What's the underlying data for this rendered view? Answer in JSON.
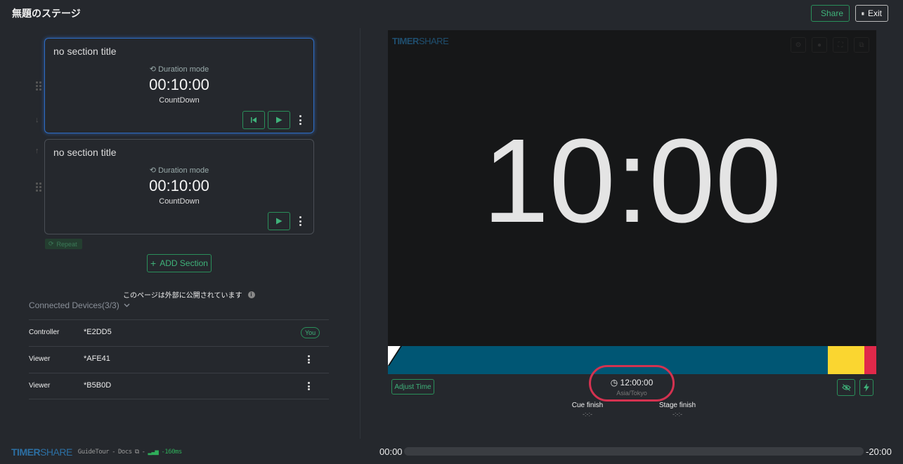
{
  "header": {
    "title": "無題のステージ",
    "share_label": "Share",
    "exit_label": "Exit"
  },
  "sections": [
    {
      "title": "no section title",
      "mode_label": "Duration mode",
      "duration": "00:10:00",
      "type": "CountDown",
      "active": true
    },
    {
      "title": "no section title",
      "mode_label": "Duration mode",
      "duration": "00:10:00",
      "type": "CountDown",
      "active": false
    }
  ],
  "repeat_label": "Repeat",
  "add_section_label": "ADD Section",
  "public_notice": "このページは外部に公開されています",
  "connected": {
    "label": "Connected Devices(3/3)",
    "devices": [
      {
        "role": "Controller",
        "id": "*E2DD5",
        "badge": "You"
      },
      {
        "role": "Viewer",
        "id": "*AFE41"
      },
      {
        "role": "Viewer",
        "id": "*B5B0D"
      }
    ]
  },
  "footer": {
    "brand_timer": "TIMER",
    "brand_share": "SHARE",
    "guide_tour": "GuideTour",
    "docs": "Docs",
    "ping": "-160ms"
  },
  "stage": {
    "brand_timer": "TIMER",
    "brand_share": "SHARE",
    "big_time": "10:00",
    "adjust_time_label": "Adjust Time",
    "clock_time": "12:00:00",
    "timezone": "Asia/Tokyo",
    "cue_finish_label": "Cue finish",
    "cue_finish_value": "-:-:-",
    "stage_finish_label": "Stage finish",
    "stage_finish_value": "-:-:-",
    "progress_colors": {
      "main": "#005674",
      "warning": "#fad630",
      "danger": "#e0294a"
    }
  },
  "timeline": {
    "start": "00:00",
    "end": "-20:00"
  }
}
